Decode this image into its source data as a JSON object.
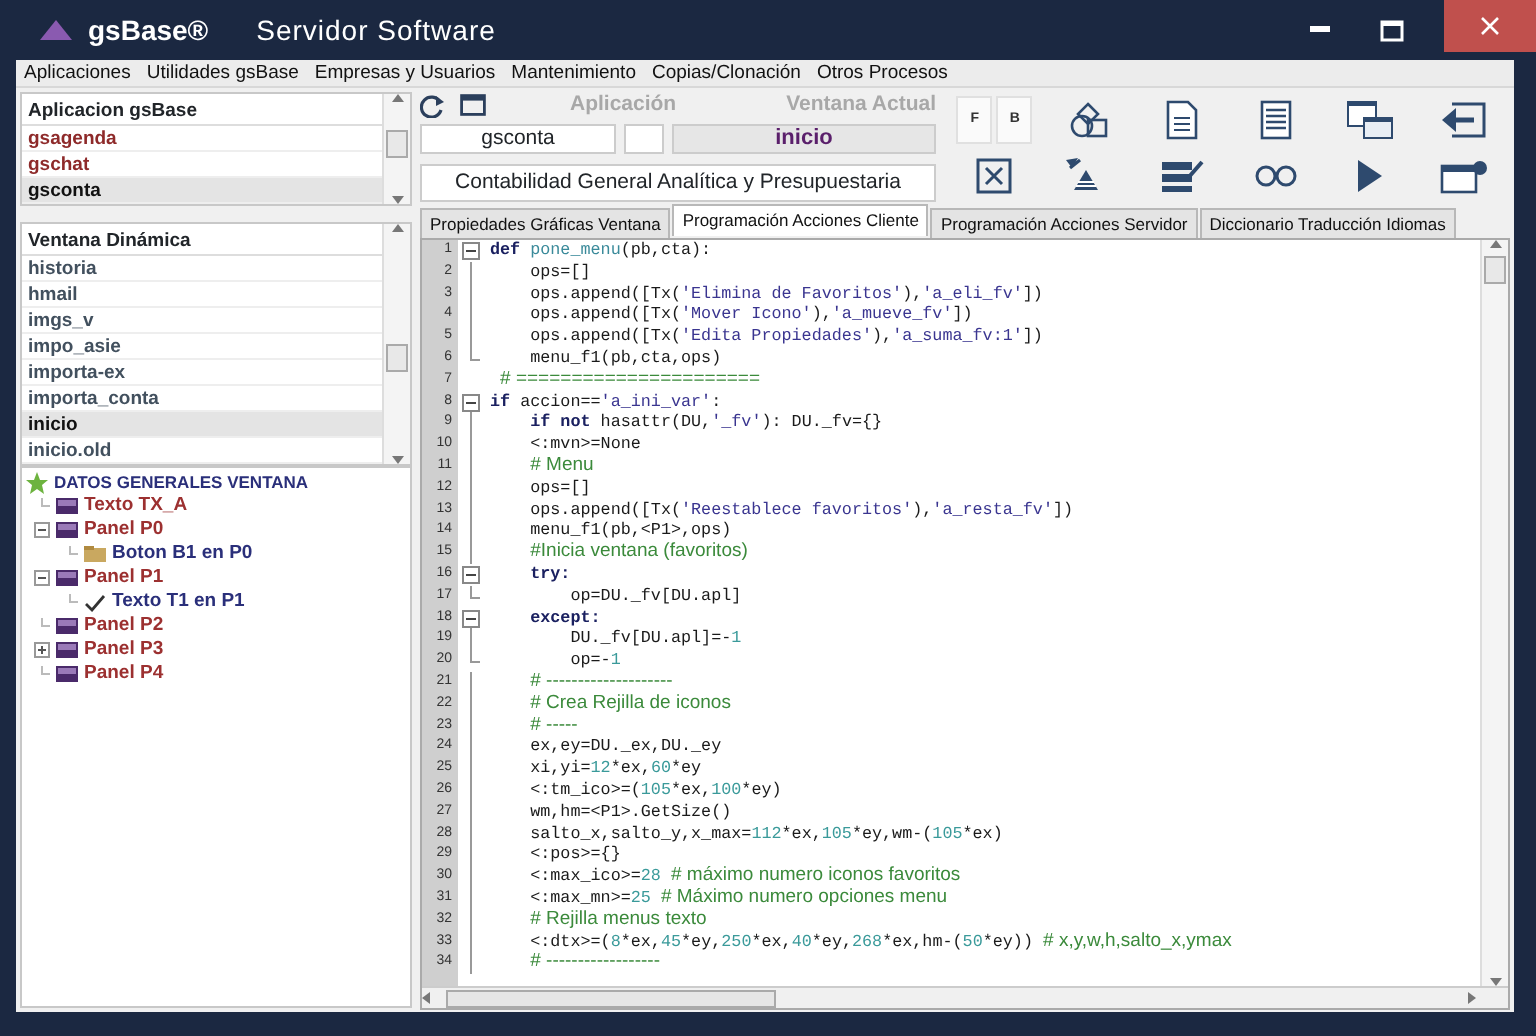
{
  "window": {
    "brand": "gsBase®",
    "title": "Servidor Software"
  },
  "menu": [
    "Aplicaciones",
    "Utilidades gsBase",
    "Empresas y Usuarios",
    "Mantenimiento",
    "Copias/Clonación",
    "Otros Procesos"
  ],
  "app_list": {
    "header": "Aplicacion gsBase",
    "items": [
      {
        "label": "gsagenda",
        "selected": false
      },
      {
        "label": "gschat",
        "selected": false
      },
      {
        "label": "gsconta",
        "selected": true
      }
    ]
  },
  "window_list": {
    "header": "Ventana Dinámica",
    "items": [
      {
        "label": "historia",
        "selected": false
      },
      {
        "label": "hmail",
        "selected": false
      },
      {
        "label": "imgs_v",
        "selected": false
      },
      {
        "label": "impo_asie",
        "selected": false
      },
      {
        "label": "importa-ex",
        "selected": false
      },
      {
        "label": "importa_conta",
        "selected": false
      },
      {
        "label": "inicio",
        "selected": true
      },
      {
        "label": "inicio.old",
        "selected": false
      }
    ]
  },
  "tree": {
    "label": "DATOS GENERALES VENTANA",
    "children": [
      {
        "label": "Texto TX_A",
        "kind": "panel",
        "color": "#9c3030"
      },
      {
        "label": "Panel P0",
        "kind": "panel",
        "color": "#9c3030",
        "expanded": true,
        "children": [
          {
            "label": "Boton B1 en P0",
            "kind": "button",
            "color": "#2a2f7a"
          }
        ]
      },
      {
        "label": "Panel P1",
        "kind": "panel",
        "color": "#9c3030",
        "expanded": true,
        "children": [
          {
            "label": "Texto T1 en P1",
            "kind": "check",
            "color": "#2a2f7a"
          }
        ]
      },
      {
        "label": "Panel P2",
        "kind": "panel",
        "color": "#9c3030"
      },
      {
        "label": "Panel P3",
        "kind": "panel",
        "color": "#9c3030",
        "expanded": false
      },
      {
        "label": "Panel P4",
        "kind": "panel",
        "color": "#9c3030"
      }
    ]
  },
  "header": {
    "app_label": "Aplicación",
    "window_label": "Ventana Actual",
    "app_field": "gsconta",
    "window_field": "inicio",
    "description": "Contabilidad General Analítica y Presupuestaria"
  },
  "tool_buttons": [
    {
      "kind": "letters",
      "labels": [
        "F",
        "B"
      ]
    },
    {
      "kind": "shapes"
    },
    {
      "kind": "document"
    },
    {
      "kind": "list-document"
    },
    {
      "kind": "windows"
    },
    {
      "kind": "exit"
    },
    {
      "kind": "cancel"
    },
    {
      "kind": "sort"
    },
    {
      "kind": "edit"
    },
    {
      "kind": "glasses"
    },
    {
      "kind": "play"
    },
    {
      "kind": "new-window"
    }
  ],
  "tabs": [
    {
      "label": "Propiedades Gráficas Ventana",
      "selected": false
    },
    {
      "label": "Programación Acciones Cliente",
      "selected": true
    },
    {
      "label": "Programación Acciones Servidor",
      "selected": false
    },
    {
      "label": "Diccionario Traducción Idiomas",
      "selected": false
    }
  ],
  "code": [
    {
      "n": "1",
      "fold_start": true,
      "segs": [
        {
          "kind": "keyword",
          "text": "def "
        },
        {
          "kind": "function",
          "text": "pone_menu"
        },
        {
          "text": "(pb,cta):"
        }
      ]
    },
    {
      "n": "2",
      "segs": [
        {
          "text": "    ops=[]"
        }
      ]
    },
    {
      "n": "3",
      "segs": [
        {
          "text": "    ops.append([Tx("
        },
        {
          "kind": "string",
          "text": "'Elimina de Favoritos'"
        },
        {
          "text": "),"
        },
        {
          "kind": "string",
          "text": "'a_eli_fv'"
        },
        {
          "text": "])"
        }
      ]
    },
    {
      "n": "4",
      "segs": [
        {
          "text": "    ops.append([Tx("
        },
        {
          "kind": "string",
          "text": "'Mover Icono'"
        },
        {
          "text": "),"
        },
        {
          "kind": "string",
          "text": "'a_mueve_fv'"
        },
        {
          "text": "])"
        }
      ]
    },
    {
      "n": "5",
      "segs": [
        {
          "text": "    ops.append([Tx("
        },
        {
          "kind": "string",
          "text": "'Edita Propiedades'"
        },
        {
          "text": "),"
        },
        {
          "kind": "string",
          "text": "'a_suma_fv:1'"
        },
        {
          "text": "])"
        }
      ]
    },
    {
      "n": "6",
      "fold_end": true,
      "segs": [
        {
          "text": "    menu_f1(pb,cta,ops)"
        }
      ]
    },
    {
      "n": "7",
      "segs": [
        {
          "kind": "comment",
          "text": " # ======================"
        }
      ]
    },
    {
      "n": "8",
      "fold_start": true,
      "segs": [
        {
          "kind": "keyword",
          "text": "if "
        },
        {
          "text": "accion=="
        },
        {
          "kind": "string",
          "text": "'a_ini_var'"
        },
        {
          "text": ":"
        }
      ]
    },
    {
      "n": "9",
      "segs": [
        {
          "kind": "keyword",
          "text": "    if not "
        },
        {
          "text": "hasattr(DU,"
        },
        {
          "kind": "string",
          "text": "'_fv'"
        },
        {
          "text": "): DU._fv={}"
        }
      ]
    },
    {
      "n": "10",
      "segs": [
        {
          "text": "    <:mvn>=None"
        }
      ]
    },
    {
      "n": "11",
      "segs": [
        {
          "kind": "comment",
          "text": "    # Menu"
        }
      ]
    },
    {
      "n": "12",
      "segs": [
        {
          "text": "    ops=[]"
        }
      ]
    },
    {
      "n": "13",
      "segs": [
        {
          "text": "    ops.append([Tx("
        },
        {
          "kind": "string",
          "text": "'Reestablece favoritos'"
        },
        {
          "text": "),"
        },
        {
          "kind": "string",
          "text": "'a_resta_fv'"
        },
        {
          "text": "])"
        }
      ]
    },
    {
      "n": "14",
      "segs": [
        {
          "text": "    menu_f1(pb,<P1>,ops)"
        }
      ]
    },
    {
      "n": "15",
      "segs": [
        {
          "kind": "comment",
          "text": "    #Inicia ventana (favoritos)"
        }
      ]
    },
    {
      "n": "16",
      "fold_start": true,
      "segs": [
        {
          "kind": "keyword",
          "text": "    try:"
        }
      ]
    },
    {
      "n": "17",
      "fold_end": true,
      "segs": [
        {
          "text": "        op=DU._fv[DU.apl]"
        }
      ]
    },
    {
      "n": "18",
      "fold_start": true,
      "segs": [
        {
          "kind": "keyword",
          "text": "    except:"
        }
      ]
    },
    {
      "n": "19",
      "segs": [
        {
          "text": "        DU._fv[DU.apl]=-"
        },
        {
          "kind": "number",
          "text": "1"
        }
      ]
    },
    {
      "n": "20",
      "fold_end": true,
      "segs": [
        {
          "text": "        op=-"
        },
        {
          "kind": "number",
          "text": "1"
        }
      ]
    },
    {
      "n": "21",
      "segs": [
        {
          "kind": "comment",
          "text": "    # --------------------"
        }
      ]
    },
    {
      "n": "22",
      "segs": [
        {
          "kind": "comment",
          "text": "    # Crea Rejilla de iconos"
        }
      ]
    },
    {
      "n": "23",
      "segs": [
        {
          "kind": "comment",
          "text": "    # -----"
        }
      ]
    },
    {
      "n": "24",
      "segs": [
        {
          "text": "    ex,ey=DU._ex,DU._ey"
        }
      ]
    },
    {
      "n": "25",
      "segs": [
        {
          "text": "    xi,yi="
        },
        {
          "kind": "number",
          "text": "12"
        },
        {
          "text": "*ex,"
        },
        {
          "kind": "number",
          "text": "60"
        },
        {
          "text": "*ey"
        }
      ]
    },
    {
      "n": "26",
      "segs": [
        {
          "text": "    <:tm_ico>=("
        },
        {
          "kind": "number",
          "text": "105"
        },
        {
          "text": "*ex,"
        },
        {
          "kind": "number",
          "text": "100"
        },
        {
          "text": "*ey)"
        }
      ]
    },
    {
      "n": "27",
      "segs": [
        {
          "text": "    wm,hm=<P1>.GetSize()"
        }
      ]
    },
    {
      "n": "28",
      "segs": [
        {
          "text": "    salto_x,salto_y,x_max="
        },
        {
          "kind": "number",
          "text": "112"
        },
        {
          "text": "*ex,"
        },
        {
          "kind": "number",
          "text": "105"
        },
        {
          "text": "*ey,wm-("
        },
        {
          "kind": "number",
          "text": "105"
        },
        {
          "text": "*ex)"
        }
      ]
    },
    {
      "n": "29",
      "segs": [
        {
          "text": "    <:pos>={}"
        }
      ]
    },
    {
      "n": "30",
      "segs": [
        {
          "text": "    <:max_ico>="
        },
        {
          "kind": "number",
          "text": "28"
        },
        {
          "kind": "comment",
          "text": " # máximo numero iconos favoritos"
        }
      ]
    },
    {
      "n": "31",
      "segs": [
        {
          "text": "    <:max_mn>="
        },
        {
          "kind": "number",
          "text": "25"
        },
        {
          "kind": "comment",
          "text": " # Máximo numero opciones menu"
        }
      ]
    },
    {
      "n": "32",
      "segs": [
        {
          "kind": "comment",
          "text": "    # Rejilla menus texto"
        }
      ]
    },
    {
      "n": "33",
      "segs": [
        {
          "text": "    <:dtx>=("
        },
        {
          "kind": "number",
          "text": "8"
        },
        {
          "text": "*ex,"
        },
        {
          "kind": "number",
          "text": "45"
        },
        {
          "text": "*ey,"
        },
        {
          "kind": "number",
          "text": "250"
        },
        {
          "text": "*ex,"
        },
        {
          "kind": "number",
          "text": "40"
        },
        {
          "text": "*ey,"
        },
        {
          "kind": "number",
          "text": "268"
        },
        {
          "text": "*ex,hm-("
        },
        {
          "kind": "number",
          "text": "50"
        },
        {
          "text": "*ey))"
        },
        {
          "kind": "comment",
          "text": " # x,y,w,h,salto_x,ymax"
        }
      ]
    },
    {
      "n": "34",
      "segs": [
        {
          "kind": "comment",
          "text": "    # ------------------"
        }
      ]
    }
  ]
}
